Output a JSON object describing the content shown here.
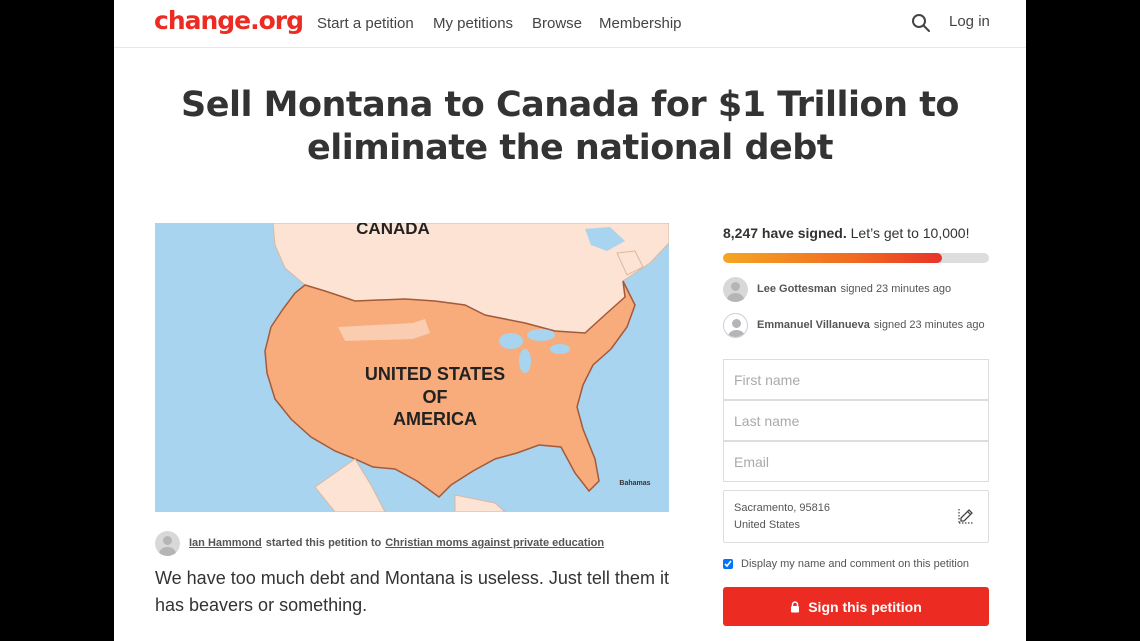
{
  "header": {
    "logo": "change.org",
    "nav": [
      "Start a petition",
      "My petitions",
      "Browse",
      "Membership"
    ],
    "login_label": "Log in",
    "icons": {
      "search": "search-icon"
    }
  },
  "petition": {
    "title": "Sell Montana to Canada for $1 Trillion to eliminate the national debt",
    "image_labels": {
      "canada": "CANADA",
      "usa": [
        "UNITED STATES",
        "OF",
        "AMERICA"
      ],
      "bahamas": "Bahamas"
    },
    "starter": {
      "name": "Ian Hammond",
      "text": "started this petition to",
      "target": "Christian moms against private education"
    },
    "description": "We have too much debt and Montana is useless. Just tell them it has beavers or something."
  },
  "signatures": {
    "count_text": "8,247 have signed.",
    "goal_text": "Let’s get to 10,000!",
    "progress_fraction": 0.8247,
    "recent": [
      {
        "name": "Lee Gottesman",
        "text": "signed 23 minutes ago"
      },
      {
        "name": "Emmanuel Villanueva",
        "text": "signed 23 minutes ago"
      }
    ]
  },
  "form": {
    "first_name_placeholder": "First name",
    "last_name_placeholder": "Last name",
    "email_placeholder": "Email",
    "location_line1": "Sacramento, 95816",
    "location_line2": "United States",
    "display_label": "Display my name and comment on this petition",
    "display_checked": true,
    "sign_label": "Sign this petition"
  },
  "colors": {
    "brand": "#ec2c22",
    "progress_start": "#f5a623",
    "progress_end": "#e8332a"
  }
}
